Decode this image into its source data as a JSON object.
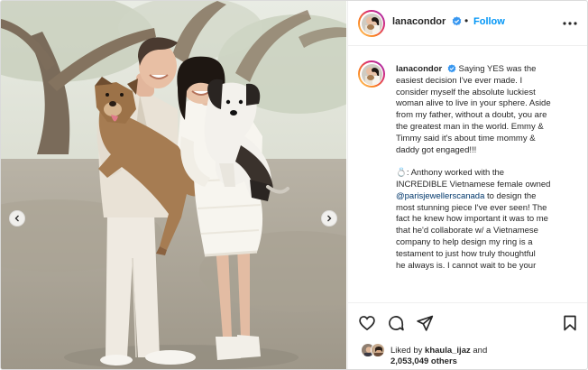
{
  "post": {
    "username": "lanacondor",
    "follow_label": "Follow",
    "dot": "•",
    "caption_lines_1": [
      "Saying YES was the",
      "easiest decision I've ever made. I",
      "consider myself the absolute luckiest",
      "woman alive to live in your sphere. Aside",
      "from my father, without a doubt, you are",
      "the greatest man in the world. Emmy &",
      "Timmy said it's about time mommy &",
      "daddy got engaged!!!"
    ],
    "caption_line_2a": "💍: Anthony worked with the",
    "caption_line_2b": "INCREDIBLE Vietnamese female owned",
    "caption_mention": "@parisjewellerscanada",
    "caption_line_2c": " to design the",
    "caption_lines_3": [
      "most stunning piece I've ever seen! The",
      "fact he knew how important it was to me",
      "that he'd collaborate w/ a Vietnamese",
      "company to help design my ring is a",
      "testament to just how truly thoughtful",
      "he always is. I cannot wait to be your"
    ],
    "likes_prefix": "Liked by ",
    "likes_user": "khaula_ijaz",
    "likes_and": " and",
    "likes_count": "2,053,049 others"
  },
  "icons": {
    "like": "heart-icon",
    "comment": "comment-icon",
    "share": "share-icon",
    "save": "bookmark-icon",
    "more": "more-icon",
    "verified": "verified-badge-icon",
    "prev": "chevron-left-icon",
    "next": "chevron-right-icon"
  },
  "colors": {
    "accent": "#0095f6",
    "mention": "#00376b",
    "verified": "#3897f0",
    "text": "#262626"
  }
}
